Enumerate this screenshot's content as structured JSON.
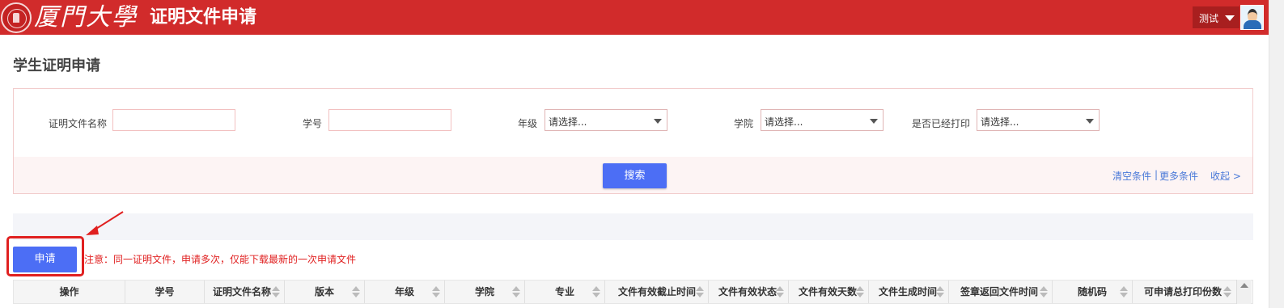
{
  "header": {
    "logo_text": "厦門大學",
    "app_title": "证明文件申请",
    "user_name": "测试",
    "brand_color": "#d12b2b"
  },
  "page": {
    "title": "学生证明申请"
  },
  "search": {
    "fields": {
      "doc_name_label": "证明文件名称",
      "student_id_label": "学号",
      "grade_label": "年级",
      "grade_value": "请选择...",
      "college_label": "学院",
      "college_value": "请选择...",
      "printed_label": "是否已经打印",
      "printed_value": "请选择..."
    },
    "search_button": "搜索",
    "clear_link": "清空条件",
    "separator": "|",
    "more_link": "更多条件",
    "collapse_link": "收起 >"
  },
  "actions": {
    "apply_button": "申请",
    "notice": "注意：同一证明文件，申请多次，仅能下载最新的一次申请文件"
  },
  "table": {
    "columns": [
      "操作",
      "学号",
      "证明文件名称",
      "版本",
      "年级",
      "学院",
      "专业",
      "文件有效截止时间",
      "文件有效状态",
      "文件有效天数",
      "文件生成时间",
      "签章返回文件时间",
      "随机码",
      "可申请总打印份数"
    ]
  },
  "icons": {
    "seal": "university-seal-icon",
    "caret": "caret-down-icon",
    "avatar": "user-avatar-icon",
    "arrow": "red-arrow-icon",
    "sort": "sort-icon"
  },
  "colors": {
    "primary_button": "#4c6ef5",
    "notice_red": "#e02020",
    "link_blue": "#4a79d8"
  }
}
